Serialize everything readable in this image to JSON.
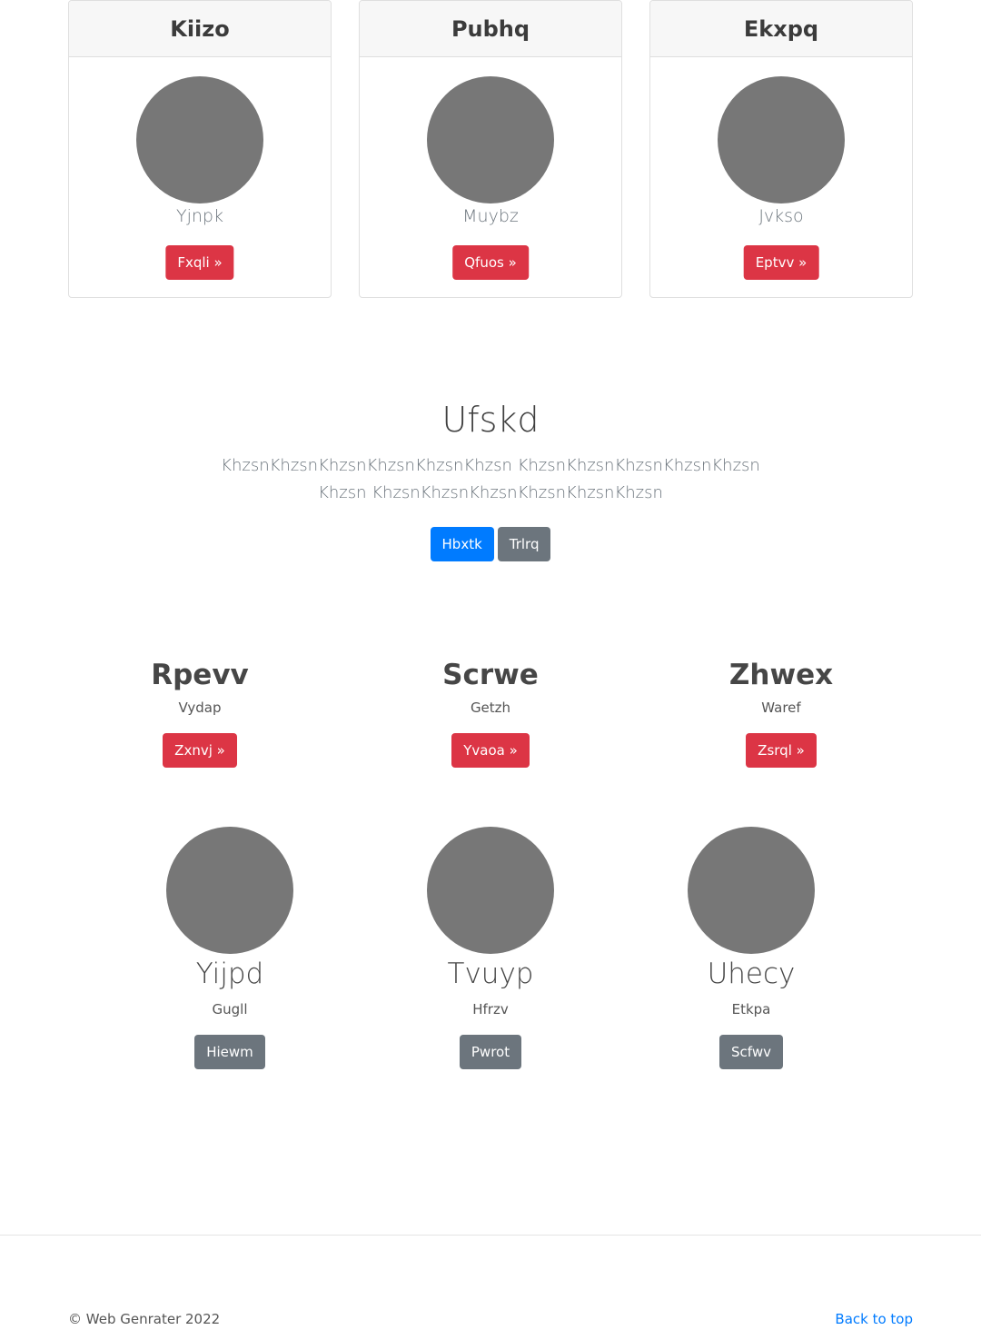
{
  "cards": [
    {
      "title": "Kiizo",
      "subtitle": "Yjnpk",
      "button": "Fxqli »"
    },
    {
      "title": "Pubhq",
      "subtitle": "Muybz",
      "button": "Qfuos »"
    },
    {
      "title": "Ekxpq",
      "subtitle": "Jvkso",
      "button": "Eptvv »"
    }
  ],
  "hero": {
    "title": "Ufskd",
    "text": "KhzsnKhzsnKhzsnKhzsnKhzsnKhzsn KhzsnKhzsnKhzsnKhzsnKhzsnKhzsn KhzsnKhzsnKhzsnKhzsnKhzsnKhzsn",
    "primary_button": "Hbxtk",
    "secondary_button": "Trlrq"
  },
  "features": [
    {
      "title": "Rpevv",
      "subtitle": "Vydap",
      "button": "Zxnvj »"
    },
    {
      "title": "Scrwe",
      "subtitle": "Getzh",
      "button": "Yvaoa »"
    },
    {
      "title": "Zhwex",
      "subtitle": "Waref",
      "button": "Zsrql »"
    }
  ],
  "people": [
    {
      "name": "Yijpd",
      "subtitle": "Gugll",
      "button": "Hiewm"
    },
    {
      "name": "Tvuyp",
      "subtitle": "Hfrzv",
      "button": "Pwrot"
    },
    {
      "name": "Uhecy",
      "subtitle": "Etkpa",
      "button": "Scfwv"
    }
  ],
  "footer": {
    "copyright": "© Web Genrater 2022",
    "back_to_top": "Back to top"
  },
  "colors": {
    "primary": "#007bff",
    "secondary": "#6c757d",
    "danger": "#dc3545",
    "avatar": "#777777"
  }
}
